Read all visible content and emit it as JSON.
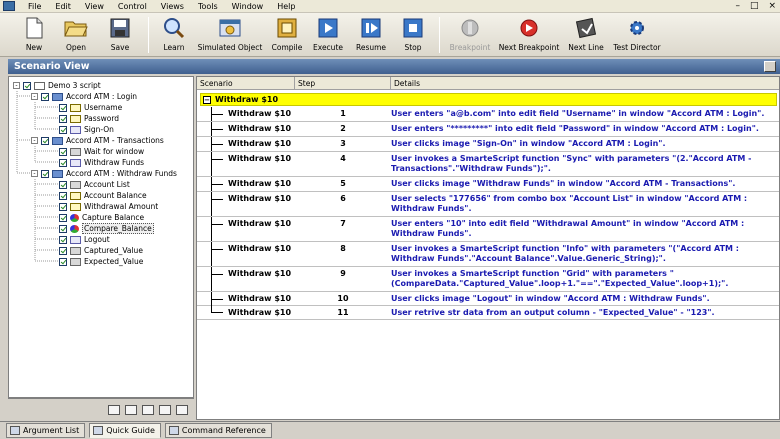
{
  "menu": [
    "File",
    "Edit",
    "View",
    "Control",
    "Views",
    "Tools",
    "Window",
    "Help"
  ],
  "window_controls": [
    "–",
    "□",
    "×"
  ],
  "toolbar": [
    {
      "label": "New",
      "icon": "new-file-icon",
      "enabled": true
    },
    {
      "label": "Open",
      "icon": "open-folder-icon",
      "enabled": true
    },
    {
      "label": "Save",
      "icon": "save-icon",
      "enabled": true
    },
    {
      "label": "Learn",
      "icon": "learn-magnifier-icon",
      "enabled": true
    },
    {
      "label": "Simulated Object",
      "icon": "simulated-object-icon",
      "enabled": true
    },
    {
      "label": "Compile",
      "icon": "compile-icon",
      "enabled": true
    },
    {
      "label": "Execute",
      "icon": "execute-icon",
      "enabled": true
    },
    {
      "label": "Resume",
      "icon": "resume-icon",
      "enabled": true
    },
    {
      "label": "Stop",
      "icon": "stop-icon",
      "enabled": true
    },
    {
      "label": "Breakpoint",
      "icon": "breakpoint-icon",
      "enabled": false
    },
    {
      "label": "Next Breakpoint",
      "icon": "next-breakpoint-icon",
      "enabled": true
    },
    {
      "label": "Next Line",
      "icon": "next-line-icon",
      "enabled": true
    },
    {
      "label": "Test Director",
      "icon": "test-director-icon",
      "enabled": true
    }
  ],
  "panel_title": "Scenario View",
  "tree": [
    {
      "label": "Demo 3 script",
      "level": 0,
      "icon": "doc",
      "expander": "-"
    },
    {
      "label": "Accord ATM : Login",
      "level": 1,
      "icon": "win",
      "expander": "-"
    },
    {
      "label": "Username",
      "level": 2,
      "icon": "field"
    },
    {
      "label": "Password",
      "level": 2,
      "icon": "field"
    },
    {
      "label": "Sign-On",
      "level": 2,
      "icon": "img"
    },
    {
      "label": "Accord ATM - Transactions",
      "level": 1,
      "icon": "win",
      "expander": "-"
    },
    {
      "label": "Wait for window",
      "level": 2,
      "icon": "btn"
    },
    {
      "label": "Withdraw Funds",
      "level": 2,
      "icon": "img"
    },
    {
      "label": "Accord ATM : Withdraw Funds",
      "level": 1,
      "icon": "win",
      "expander": "-"
    },
    {
      "label": "Account List",
      "level": 2,
      "icon": "btn"
    },
    {
      "label": "Account Balance",
      "level": 2,
      "icon": "field"
    },
    {
      "label": "Withdrawal Amount",
      "level": 2,
      "icon": "field"
    },
    {
      "label": "Capture Balance",
      "level": 2,
      "icon": "func"
    },
    {
      "label": "Compare_Balance",
      "level": 2,
      "icon": "func",
      "selected": true
    },
    {
      "label": "Logout",
      "level": 2,
      "icon": "img"
    },
    {
      "label": "Captured_Value",
      "level": 2,
      "icon": "btn"
    },
    {
      "label": "Expected_Value",
      "level": 2,
      "icon": "btn"
    }
  ],
  "grid": {
    "columns": [
      "Scenario",
      "Step",
      "Details"
    ],
    "group": "Withdraw $10",
    "rows": [
      {
        "scenario": "Withdraw $10",
        "step": "1",
        "details": "User enters \"a@b.com\" into edit field \"Username\" in window \"Accord ATM : Login\"."
      },
      {
        "scenario": "Withdraw $10",
        "step": "2",
        "details": "User enters \"*********\" into edit field \"Password\" in window \"Accord ATM : Login\"."
      },
      {
        "scenario": "Withdraw $10",
        "step": "3",
        "details": "User clicks image \"Sign-On\" in window \"Accord ATM : Login\"."
      },
      {
        "scenario": "Withdraw $10",
        "step": "4",
        "details": "User invokes a SmarteScript function \"Sync\" with parameters \"(2.\"Accord ATM - Transactions\".\"Withdraw Funds\");\"."
      },
      {
        "scenario": "Withdraw $10",
        "step": "5",
        "details": "User clicks image \"Withdraw Funds\" in window \"Accord ATM - Transactions\"."
      },
      {
        "scenario": "Withdraw $10",
        "step": "6",
        "details": "User selects \"177656\" from combo box \"Account List\" in window \"Accord ATM : Withdraw Funds\"."
      },
      {
        "scenario": "Withdraw $10",
        "step": "7",
        "details": "User enters \"10\" into edit field \"Withdrawal Amount\" in window \"Accord ATM : Withdraw Funds\"."
      },
      {
        "scenario": "Withdraw $10",
        "step": "8",
        "details": "User invokes a SmarteScript function \"Info\" with parameters \"(\"Accord ATM : Withdraw Funds\".\"Account Balance\".Value.Generic_String);\"."
      },
      {
        "scenario": "Withdraw $10",
        "step": "9",
        "details": "User invokes a SmarteScript function \"Grid\" with parameters \"(CompareData.\"Captured_Value\".loop+1.\"==\".\"Expected_Value\".loop+1);\"."
      },
      {
        "scenario": "Withdraw $10",
        "step": "10",
        "details": "User clicks image \"Logout\" in window \"Accord ATM : Withdraw Funds\"."
      },
      {
        "scenario": "Withdraw $10",
        "step": "11",
        "details": "User retrive str data from an output column - \"Expected_Value\" - \"123\"."
      }
    ]
  },
  "tabs": [
    {
      "label": "Argument List",
      "active": false
    },
    {
      "label": "Quick Guide",
      "active": true
    },
    {
      "label": "Command Reference",
      "active": false
    }
  ]
}
